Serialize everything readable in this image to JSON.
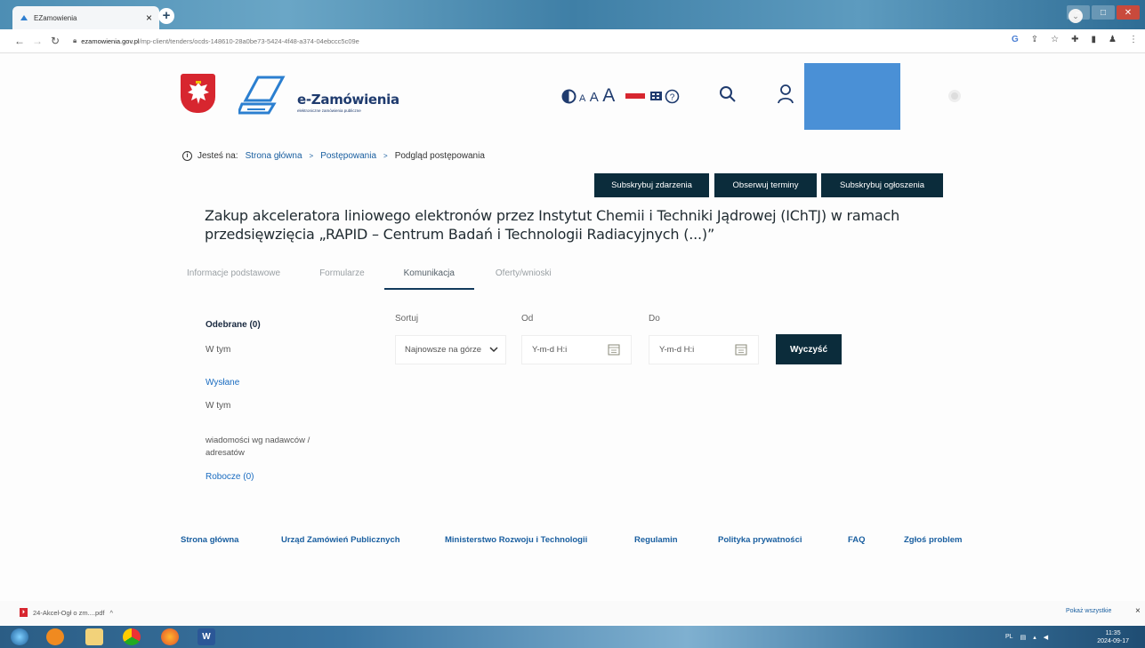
{
  "browser": {
    "tab_title": "EZamowienia",
    "tab_close": "×",
    "new_tab": "+",
    "url_host": "ezamowienia.gov.pl",
    "url_path": "/mp-client/tenders/ocds-148610-28a0be73-5424-4f48-a374-04ebccc5c09e"
  },
  "header": {
    "logo_name": "e-Zamówienia",
    "logo_sub": "elektroniczne zamówienia publiczne",
    "font_size_small": "A",
    "font_size_medium": "A",
    "font_size_large": "A",
    "colors": {
      "brand": "#1f3b6e",
      "flag_red": "#d7262f",
      "dark_button": "#0b2c3b",
      "link": "#1a5fa0"
    }
  },
  "breadcrumb": {
    "prefix": "Jesteś na:",
    "items": [
      "Strona główna",
      "Postępowania",
      "Podgląd postępowania"
    ],
    "separator": ">"
  },
  "actions": {
    "subscribe_events": "Subskrybuj zdarzenia",
    "watch_deadlines": "Obserwuj terminy",
    "subscribe_notices": "Subskrybuj ogłoszenia"
  },
  "page_title": "Zakup akceleratora liniowego elektronów przez Instytut Chemii i Techniki Jądrowej (IChTJ) w ramach przedsięwzięcia „RAPID – Centrum Badań i Technologii Radiacyjnych (...)”",
  "tabs": [
    {
      "label": "Informacje podstawowe",
      "active": false
    },
    {
      "label": "Formularze",
      "active": false
    },
    {
      "label": "Komunikacja",
      "active": true
    },
    {
      "label": "Oferty/wnioski",
      "active": false
    }
  ],
  "sidebar": {
    "received": "Odebrane (0)",
    "received_sub": "W tym",
    "sent": "Wysłane",
    "sent_sub": "W tym",
    "by_sender": "wiadomości wg nadawców / adresatów",
    "drafts": "Robocze (0)"
  },
  "filters": {
    "sort_label": "Sortuj",
    "sort_value": "Najnowsze na górze",
    "from_label": "Od",
    "from_placeholder": "Y-m-d H:i",
    "to_label": "Do",
    "to_placeholder": "Y-m-d H:i",
    "clear_button": "Wyczyść"
  },
  "footer": {
    "links": [
      "Strona główna",
      "Urząd Zamówień Publicznych",
      "Ministerstwo Rozwoju i Technologii",
      "Regulamin",
      "Polityka prywatności",
      "FAQ",
      "Zgłoś problem"
    ]
  },
  "downloads": {
    "file": "24-Akcel-Ogł o zm....pdf",
    "show_all": "Pokaż wszystkie",
    "close": "×"
  },
  "taskbar": {
    "time": "11:35",
    "date": "2024-09-17"
  }
}
